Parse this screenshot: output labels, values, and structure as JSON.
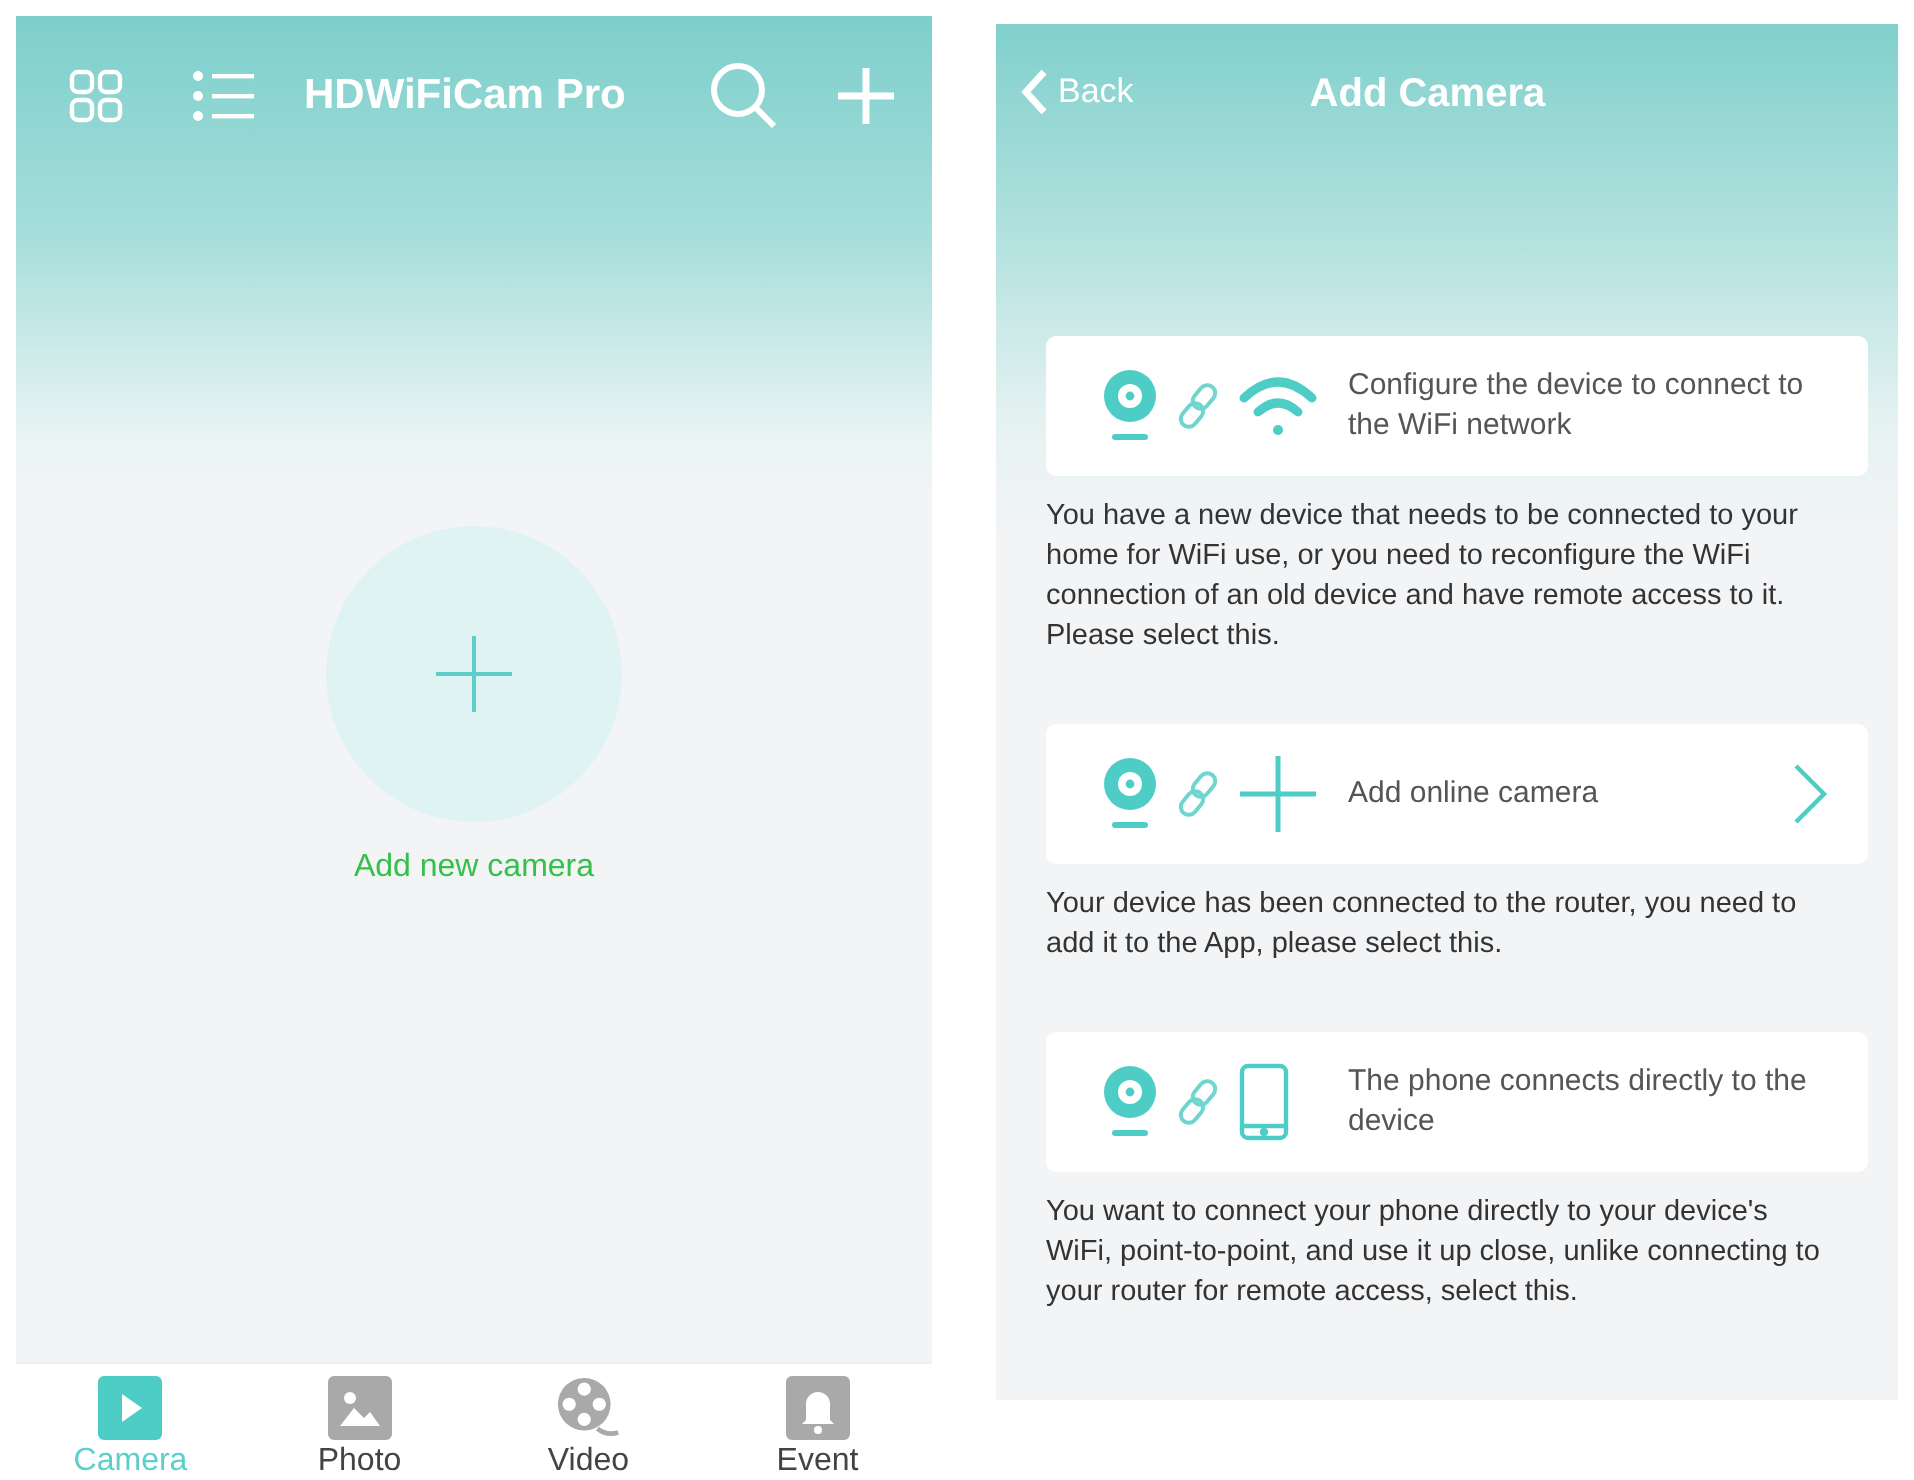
{
  "home": {
    "title": "HDWiFiCam Pro",
    "add_label": "Add new camera",
    "tabs": [
      {
        "label": "Camera",
        "selected": true
      },
      {
        "label": "Photo",
        "selected": false
      },
      {
        "label": "Video",
        "selected": false
      },
      {
        "label": "Event",
        "selected": false
      }
    ]
  },
  "add_camera": {
    "back": "Back",
    "title": "Add Camera",
    "options": [
      {
        "kind": "wifi",
        "label": "Configure the device to connect to the WiFi network",
        "chevron": false,
        "description": "You have a new device that needs to be connected to your home for WiFi use, or you need to reconfigure the WiFi connection of an old device and have remote access to it. Please select this."
      },
      {
        "kind": "online",
        "label": "Add online camera",
        "chevron": true,
        "description": "Your device has been connected to the router, you need to add it to the App, please select this."
      },
      {
        "kind": "direct",
        "label": "The phone connects directly to the device",
        "chevron": false,
        "description": "You want to connect your phone directly to your device's WiFi, point-to-point, and use it up close, unlike connecting to your router for remote access, select this."
      }
    ]
  }
}
